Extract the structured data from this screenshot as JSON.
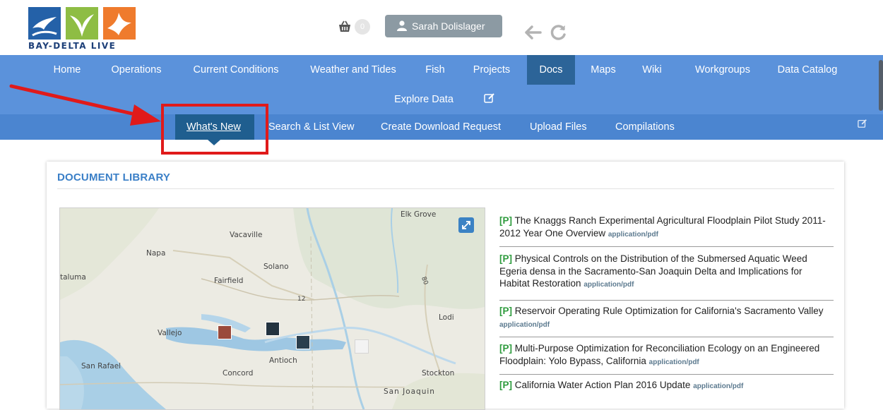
{
  "header": {
    "logo_text": "BAY-DELTA LIVE",
    "cart_count": "0",
    "user_name": "Sarah Dolislager"
  },
  "main_nav": {
    "items": [
      "Home",
      "Operations",
      "Current Conditions",
      "Weather and Tides",
      "Fish",
      "Projects",
      "Docs",
      "Maps",
      "Wiki",
      "Workgroups",
      "Data Catalog",
      "Explore Data"
    ],
    "active": "Docs"
  },
  "sub_nav": {
    "items": [
      "What's New",
      "Search & List View",
      "Create Download Request",
      "Upload Files",
      "Compilations"
    ],
    "active": "What's New"
  },
  "panel": {
    "title": "DOCUMENT LIBRARY"
  },
  "map": {
    "labels": [
      "Elk Grove",
      "Vacaville",
      "Napa",
      "Solano",
      "taluma",
      "Fairfield",
      "12",
      "80",
      "Lodi",
      "Vallejo",
      "San Rafael",
      "Antioch",
      "Concord",
      "Stockton",
      "San Joaquin"
    ]
  },
  "documents": [
    {
      "prefix": "[P]",
      "title": "The Knaggs Ranch Experimental Agricultural Floodplain Pilot Study 2011-2012 Year One Overview",
      "mime": "application/pdf"
    },
    {
      "prefix": "[P]",
      "title": "Physical Controls on the Distribution of the Submersed Aquatic Weed Egeria densa in the Sacramento-San Joaquin Delta and Implications for Habitat Restoration",
      "mime": "application/pdf"
    },
    {
      "prefix": "[P]",
      "title": "Reservoir Operating Rule Optimization for California's Sacramento Valley",
      "mime": "application/pdf"
    },
    {
      "prefix": "[P]",
      "title": "Multi-Purpose Optimization for Reconciliation Ecology on an Engineered Floodplain: Yolo Bypass, California",
      "mime": "application/pdf"
    },
    {
      "prefix": "[P]",
      "title": "California Water Action Plan 2016 Update",
      "mime": "application/pdf"
    }
  ],
  "colors": {
    "nav_bg": "#5b92db",
    "subnav_bg": "#4b85d0",
    "active_bg": "#2c6498",
    "accent": "#3a7fc7",
    "annotation": "#e01a1a"
  }
}
